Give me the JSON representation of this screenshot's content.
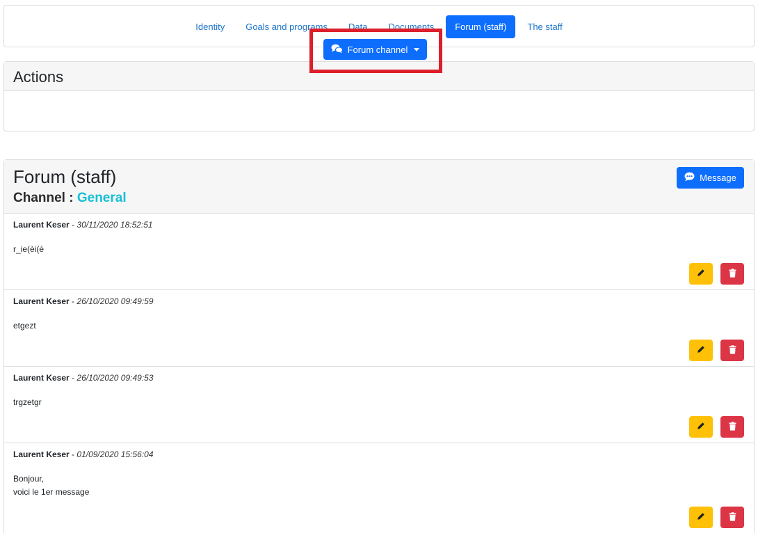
{
  "nav": {
    "tabs": [
      {
        "label": "Identity"
      },
      {
        "label": "Goals and programs"
      },
      {
        "label": "Data"
      },
      {
        "label": "Documents"
      },
      {
        "label": "Forum (staff)",
        "active": true
      },
      {
        "label": "The staff"
      }
    ]
  },
  "actions": {
    "title": "Actions",
    "forum_channel_label": "Forum channel",
    "forum_channel_icon": "comments-icon"
  },
  "forum": {
    "title": "Forum (staff)",
    "channel_prefix": "Channel :",
    "channel_name": "General",
    "message_button_label": "Message",
    "message_button_icon": "comment-dots-icon",
    "messages": [
      {
        "author": "Laurent Keser",
        "separator": "-",
        "date": "30/11/2020 18:52:51",
        "lines": [
          "r_ie(èi(è"
        ]
      },
      {
        "author": "Laurent Keser",
        "separator": "-",
        "date": "26/10/2020 09:49:59",
        "lines": [
          "etgezt"
        ]
      },
      {
        "author": "Laurent Keser",
        "separator": "-",
        "date": "26/10/2020 09:49:53",
        "lines": [
          "trgzetgr"
        ]
      },
      {
        "author": "Laurent Keser",
        "separator": "-",
        "date": "01/09/2020 15:56:04",
        "lines": [
          "Bonjour,",
          "voici le 1er message"
        ]
      }
    ]
  },
  "colors": {
    "primary": "#0d6efd",
    "warning": "#ffc107",
    "danger": "#dc3545",
    "channel": "#17c0d6",
    "highlight": "#dc1f2b"
  }
}
